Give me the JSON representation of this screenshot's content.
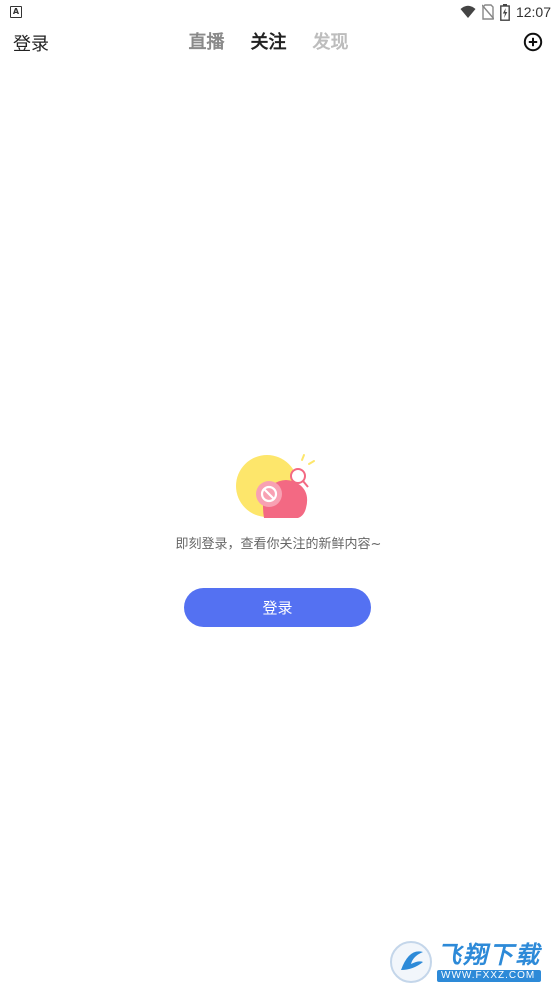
{
  "status_bar": {
    "left_icon_glyph": "A",
    "time": "12:07",
    "icons": [
      "wifi-icon",
      "no-sim-icon",
      "battery-charging-icon"
    ]
  },
  "header": {
    "login_label": "登录",
    "tabs": [
      {
        "label": "直播",
        "state": "inactive"
      },
      {
        "label": "关注",
        "state": "active"
      },
      {
        "label": "发现",
        "state": "muted"
      }
    ],
    "add_icon": "plus-circle-icon"
  },
  "empty_state": {
    "illustration": "blocked-bell-illustration",
    "message": "即刻登录，查看你关注的新鲜内容~",
    "button_label": "登录",
    "button_color": "#5471f2"
  },
  "watermark": {
    "title": "飞翔下载",
    "url": "WWW.FXXZ.COM"
  }
}
